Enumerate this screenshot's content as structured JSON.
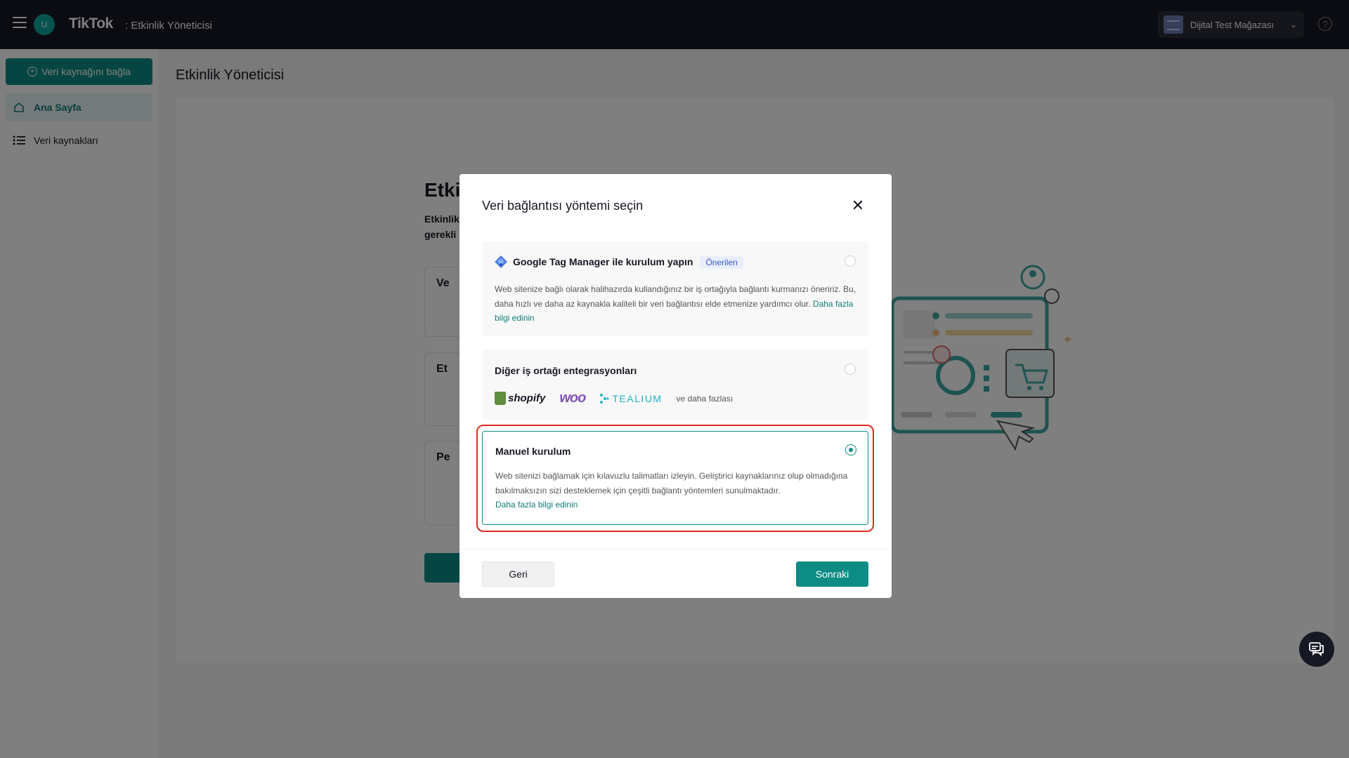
{
  "topbar": {
    "avatar_letter": "U",
    "logo": "TikTok",
    "app_name": ": Etkinlik Yöneticisi",
    "account_name": "Dijital Test Mağazası"
  },
  "sidebar": {
    "connect_label": "Veri kaynağını bağla",
    "items": [
      {
        "label": "Ana Sayfa",
        "icon": "home-icon",
        "active": true
      },
      {
        "label": "Veri kaynakları",
        "icon": "list-icon",
        "active": false
      }
    ]
  },
  "main": {
    "page_title": "Etkinlik Yöneticisi",
    "bg_heading": "Etki",
    "bg_line1": "Etkinlik",
    "bg_line2": "gerekli",
    "bg_cards": [
      "Ve",
      "Et",
      "Pe"
    ]
  },
  "modal": {
    "title": "Veri bağlantısı yöntemi seçin",
    "options": [
      {
        "title": "Google Tag Manager ile kurulum yapın",
        "badge": "Önerilen",
        "desc": "Web sitenize bağlı olarak halihazırda kullandığınız bir iş ortağıyla bağlantı kurmanızı öneririz. Bu, daha hızlı ve daha az kaynakla kaliteli bir veri bağlantısı elde etmenize yardımcı olur.",
        "link": "Daha fazla bilgi edinin",
        "selected": false
      },
      {
        "title": "Diğer iş ortağı entegrasyonları",
        "partners": [
          "shopify",
          "woo",
          "TEALIUM"
        ],
        "more": "ve daha fazlası",
        "selected": false
      },
      {
        "title": "Manuel kurulum",
        "desc": "Web sitenizi bağlamak için kılavuzlu talimatları izleyin. Geliştirici kaynaklarınız olup olmadığına bakılmaksızın sizi desteklemek için çeşitli bağlantı yöntemleri sunulmaktadır.",
        "link": "Daha fazla bilgi edinin",
        "selected": true
      }
    ],
    "back_label": "Geri",
    "next_label": "Sonraki"
  },
  "colors": {
    "topbar": "#161823",
    "accent": "#0c8c85",
    "highlight": "#e02a1f",
    "badge_bg": "#e9eefc"
  }
}
